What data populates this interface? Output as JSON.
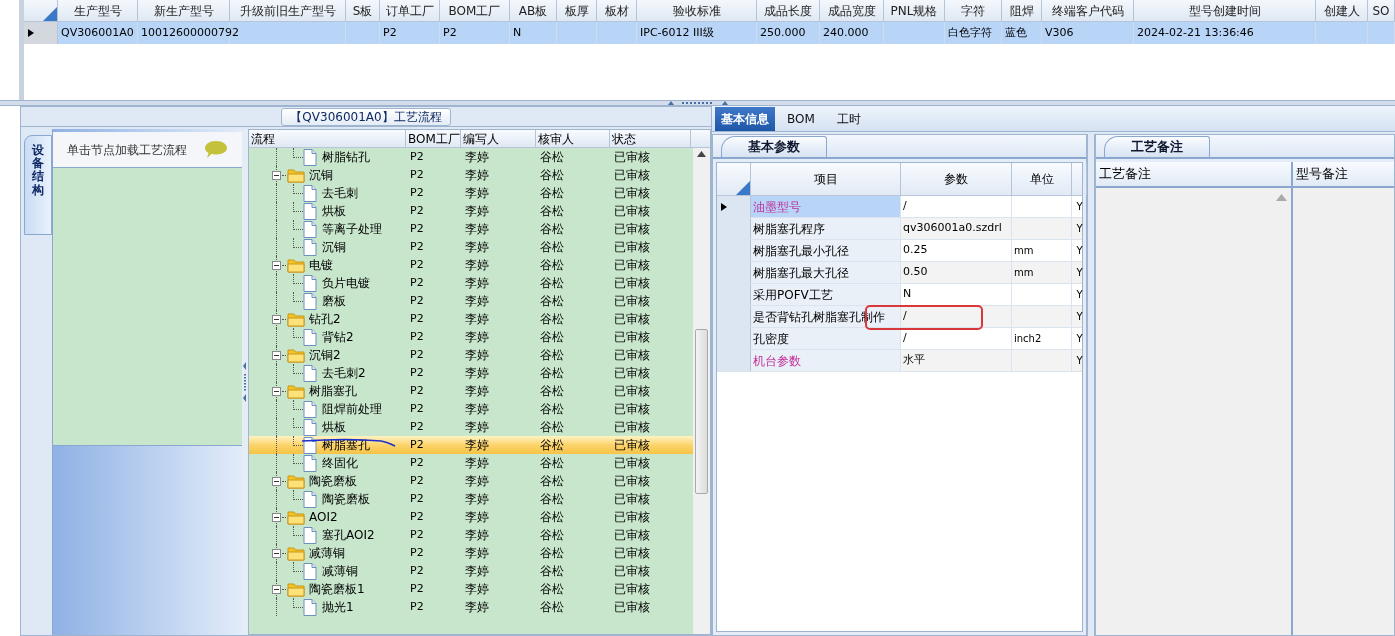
{
  "main_grid": {
    "columns": [
      "生产型号",
      "新生产型号",
      "升级前旧生产型号",
      "S板",
      "订单工厂",
      "BOM工厂",
      "AB板",
      "板厚",
      "板材",
      "验收标准",
      "成品长度",
      "成品宽度",
      "PNL规格",
      "字符",
      "阻焊",
      "终端客户代码",
      "型号创建时间",
      "创建人",
      "SO"
    ],
    "rows": [
      {
        "selected": true,
        "cells": [
          "QV306001A0",
          "10012600000792",
          null,
          null,
          "P2",
          "P2",
          "N",
          null,
          null,
          "IPC-6012 III级",
          "250.000",
          "240.000",
          null,
          "白色字符",
          "蓝色",
          "V306",
          "2024-02-21 13:36:46",
          null,
          null
        ]
      }
    ]
  },
  "flow_panel": {
    "title": "【QV306001A0】工艺流程",
    "side_tab": "设备结构",
    "hint": "单击节点加载工艺流程",
    "tree": {
      "columns": [
        "流程",
        "BOM工厂",
        "编写人",
        "核审人",
        "状态"
      ],
      "nodes": [
        {
          "children": [
            {
              "kind": "leaf",
              "label": "树脂钻孔",
              "bom": "P2",
              "author": "李婷",
              "reviewer": "谷松",
              "status": "已审核",
              "selected": false
            }
          ]
        },
        {
          "kind": "folder",
          "label": "沉铜",
          "bom": "P2",
          "author": "李婷",
          "reviewer": "谷松",
          "status": "已审核",
          "selected": false,
          "expanded": true,
          "children": [
            {
              "kind": "leaf",
              "label": "去毛刺",
              "bom": "P2",
              "author": "李婷",
              "reviewer": "谷松",
              "status": "已审核",
              "selected": false
            },
            {
              "kind": "leaf",
              "label": "烘板",
              "bom": "P2",
              "author": "李婷",
              "reviewer": "谷松",
              "status": "已审核",
              "selected": false
            },
            {
              "kind": "leaf",
              "label": "等离子处理",
              "bom": "P2",
              "author": "李婷",
              "reviewer": "谷松",
              "status": "已审核",
              "selected": false
            },
            {
              "kind": "leaf",
              "label": "沉铜",
              "bom": "P2",
              "author": "李婷",
              "reviewer": "谷松",
              "status": "已审核",
              "selected": false
            }
          ]
        },
        {
          "kind": "folder",
          "label": "电镀",
          "bom": "P2",
          "author": "李婷",
          "reviewer": "谷松",
          "status": "已审核",
          "selected": false,
          "expanded": true,
          "children": [
            {
              "kind": "leaf",
              "label": "负片电镀",
              "bom": "P2",
              "author": "李婷",
              "reviewer": "谷松",
              "status": "已审核",
              "selected": false
            },
            {
              "kind": "leaf",
              "label": "磨板",
              "bom": "P2",
              "author": "李婷",
              "reviewer": "谷松",
              "status": "已审核",
              "selected": false
            }
          ]
        },
        {
          "kind": "folder",
          "label": "钻孔2",
          "bom": "P2",
          "author": "李婷",
          "reviewer": "谷松",
          "status": "已审核",
          "selected": false,
          "expanded": true,
          "children": [
            {
              "kind": "leaf",
              "label": "背钻2",
              "bom": "P2",
              "author": "李婷",
              "reviewer": "谷松",
              "status": "已审核",
              "selected": false
            }
          ]
        },
        {
          "kind": "folder",
          "label": "沉铜2",
          "bom": "P2",
          "author": "李婷",
          "reviewer": "谷松",
          "status": "已审核",
          "selected": false,
          "expanded": true,
          "children": [
            {
              "kind": "leaf",
              "label": "去毛刺2",
              "bom": "P2",
              "author": "李婷",
              "reviewer": "谷松",
              "status": "已审核",
              "selected": false
            }
          ]
        },
        {
          "kind": "folder",
          "label": "树脂塞孔",
          "bom": "P2",
          "author": "李婷",
          "reviewer": "谷松",
          "status": "已审核",
          "selected": false,
          "expanded": true,
          "children": [
            {
              "kind": "leaf",
              "label": "阻焊前处理",
              "bom": "P2",
              "author": "李婷",
              "reviewer": "谷松",
              "status": "已审核",
              "selected": false
            },
            {
              "kind": "leaf",
              "label": "烘板",
              "bom": "P2",
              "author": "李婷",
              "reviewer": "谷松",
              "status": "已审核",
              "selected": false
            },
            {
              "kind": "leaf",
              "label": "树脂塞孔",
              "bom": "P2",
              "author": "李婷",
              "reviewer": "谷松",
              "status": "已审核",
              "selected": true
            },
            {
              "kind": "leaf",
              "label": "终固化",
              "bom": "P2",
              "author": "李婷",
              "reviewer": "谷松",
              "status": "已审核",
              "selected": false
            }
          ]
        },
        {
          "kind": "folder",
          "label": "陶瓷磨板",
          "bom": "P2",
          "author": "李婷",
          "reviewer": "谷松",
          "status": "已审核",
          "selected": false,
          "expanded": true,
          "children": [
            {
              "kind": "leaf",
              "label": "陶瓷磨板",
              "bom": "P2",
              "author": "李婷",
              "reviewer": "谷松",
              "status": "已审核",
              "selected": false
            }
          ]
        },
        {
          "kind": "folder",
          "label": "AOI2",
          "bom": "P2",
          "author": "李婷",
          "reviewer": "谷松",
          "status": "已审核",
          "selected": false,
          "expanded": true,
          "children": [
            {
              "kind": "leaf",
              "label": "塞孔AOI2",
              "bom": "P2",
              "author": "李婷",
              "reviewer": "谷松",
              "status": "已审核",
              "selected": false
            }
          ]
        },
        {
          "kind": "folder",
          "label": "减薄铜",
          "bom": "P2",
          "author": "李婷",
          "reviewer": "谷松",
          "status": "已审核",
          "selected": false,
          "expanded": true,
          "children": [
            {
              "kind": "leaf",
              "label": "减薄铜",
              "bom": "P2",
              "author": "李婷",
              "reviewer": "谷松",
              "status": "已审核",
              "selected": false
            }
          ]
        },
        {
          "kind": "folder",
          "label": "陶瓷磨板1",
          "bom": "P2",
          "author": "李婷",
          "reviewer": "谷松",
          "status": "已审核",
          "selected": false,
          "expanded": true,
          "children": [
            {
              "kind": "leaf",
              "label": "抛光1",
              "bom": "P2",
              "author": "李婷",
              "reviewer": "谷松",
              "status": "已审核",
              "selected": false
            }
          ]
        }
      ]
    }
  },
  "detail": {
    "tabs": [
      {
        "label": "基本信息",
        "selected": true
      },
      {
        "label": "BOM",
        "selected": false
      },
      {
        "label": "工时",
        "selected": false
      }
    ],
    "params": {
      "tab": "基本参数",
      "columns": [
        "项目",
        "参数",
        "单位"
      ],
      "rows": [
        {
          "item": "油墨型号",
          "value": "/",
          "unit": null,
          "flag": "Y",
          "selected": true,
          "highlighted": true
        },
        {
          "item": "树脂塞孔程序",
          "value": "qv306001a0.szdrl",
          "unit": null,
          "flag": "Y",
          "selected": false,
          "highlighted": false
        },
        {
          "item": "树脂塞孔最小孔径",
          "value": "0.25",
          "unit": "mm",
          "flag": "Y",
          "selected": false,
          "highlighted": false
        },
        {
          "item": "树脂塞孔最大孔径",
          "value": "0.50",
          "unit": "mm",
          "flag": "Y",
          "selected": false,
          "highlighted": false
        },
        {
          "item": "采用POFV工艺",
          "value": "N",
          "unit": null,
          "flag": "Y",
          "selected": false,
          "highlighted": false
        },
        {
          "item": "是否背钻孔树脂塞孔制作",
          "value": "/",
          "unit": null,
          "flag": "Y",
          "selected": false,
          "highlighted": false
        },
        {
          "item": "孔密度",
          "value": "/",
          "unit": "inch2",
          "flag": "Y",
          "selected": false,
          "highlighted": false
        },
        {
          "item": "机台参数",
          "value": "水平",
          "unit": null,
          "flag": "Y",
          "selected": false,
          "highlighted": true
        }
      ]
    },
    "notes": {
      "tab": "工艺备注",
      "columns": [
        "工艺备注",
        "型号备注"
      ]
    }
  }
}
